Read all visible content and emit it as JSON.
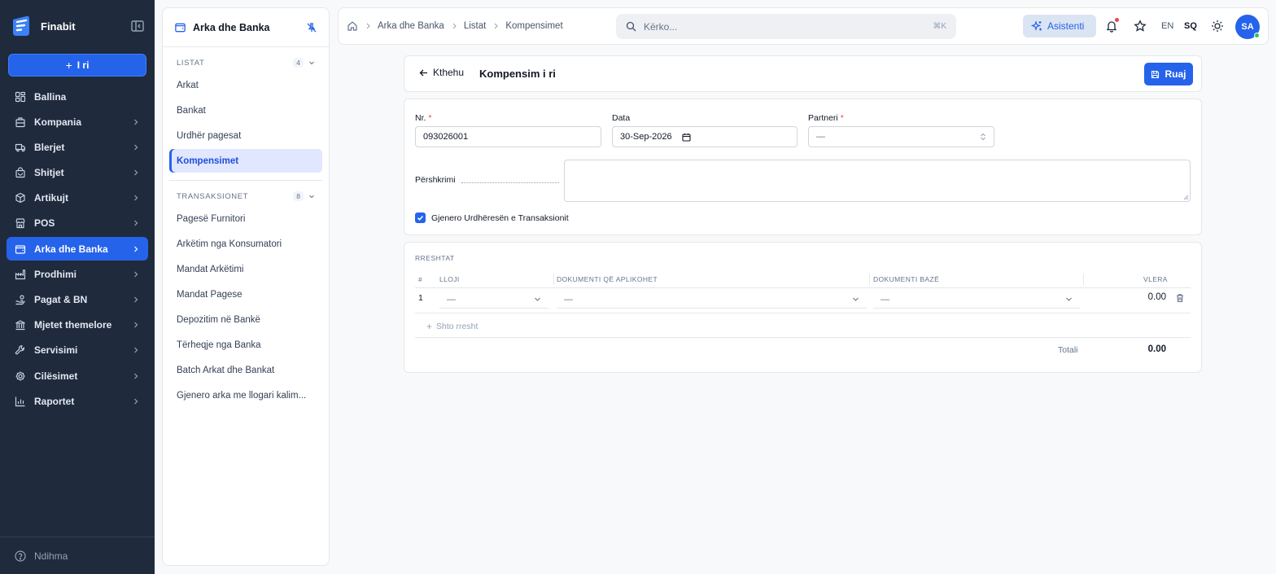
{
  "app": {
    "name": "Finabit",
    "new_label": "I ri"
  },
  "nav": [
    {
      "label": "Ballina",
      "icon": "dashboard-icon",
      "chevron": false
    },
    {
      "label": "Kompania",
      "icon": "building-icon",
      "chevron": true
    },
    {
      "label": "Blerjet",
      "icon": "truck-icon",
      "chevron": true
    },
    {
      "label": "Shitjet",
      "icon": "bag-icon",
      "chevron": true
    },
    {
      "label": "Artikujt",
      "icon": "box-icon",
      "chevron": true
    },
    {
      "label": "POS",
      "icon": "store-icon",
      "chevron": true
    },
    {
      "label": "Arka dhe Banka",
      "icon": "wallet-icon",
      "chevron": true,
      "active": true
    },
    {
      "label": "Prodhimi",
      "icon": "factory-icon",
      "chevron": true
    },
    {
      "label": "Pagat & BN",
      "icon": "hand-coins-icon",
      "chevron": true
    },
    {
      "label": "Mjetet themelore",
      "icon": "landmark-icon",
      "chevron": true
    },
    {
      "label": "Servisimi",
      "icon": "wrench-icon",
      "chevron": true
    },
    {
      "label": "Cilësimet",
      "icon": "gear-icon",
      "chevron": true
    },
    {
      "label": "Raportet",
      "icon": "chart-icon",
      "chevron": true
    }
  ],
  "help_label": "Ndihma",
  "subpanel": {
    "title": "Arka dhe Banka",
    "sections": [
      {
        "title": "LISTAT",
        "count": "4",
        "items": [
          "Arkat",
          "Bankat",
          "Urdhër pagesat",
          "Kompensimet"
        ],
        "active": 3
      },
      {
        "title": "TRANSAKSIONET",
        "count": "8",
        "items": [
          "Pagesë Furnitori",
          "Arkëtim nga Konsumatori",
          "Mandat Arkëtimi",
          "Mandat Pagese",
          "Depozitim në Bankë",
          "Tërheqje nga Banka",
          "Batch Arkat dhe Bankat",
          "Gjenero arka me llogari kalim..."
        ],
        "active": -1
      }
    ]
  },
  "topbar": {
    "breadcrumb": [
      "Arka dhe Banka",
      "Listat",
      "Kompensimet"
    ],
    "search_placeholder": "Kërko...",
    "search_shortcut": "⌘K",
    "assistant_label": "Asistenti",
    "lang_en": "EN",
    "lang_sq": "SQ",
    "avatar": "SA"
  },
  "form": {
    "back_label": "Kthehu",
    "title": "Kompensim i ri",
    "save_label": "Ruaj",
    "nr_label": "Nr.",
    "nr_value": "093026001",
    "data_label": "Data",
    "data_value": "30-Sep-2026",
    "partner_label": "Partneri",
    "partner_value": "—",
    "desc_label": "Përshkrimi",
    "checkbox_label": "Gjenero Urdhëresën e Transaksionit",
    "checkbox_checked": true
  },
  "rows": {
    "title": "RRESHTAT",
    "columns": [
      "#",
      "LLOJI",
      "DOKUMENTI QË APLIKOHET",
      "DOKUMENTI BAZË",
      "VLERA"
    ],
    "items": [
      {
        "num": "1",
        "lloji": "—",
        "dok_aplikohet": "—",
        "dok_baze": "—",
        "vlera": "0.00"
      }
    ],
    "add_label": "Shto rresht",
    "total_label": "Totali",
    "total_value": "0.00"
  }
}
